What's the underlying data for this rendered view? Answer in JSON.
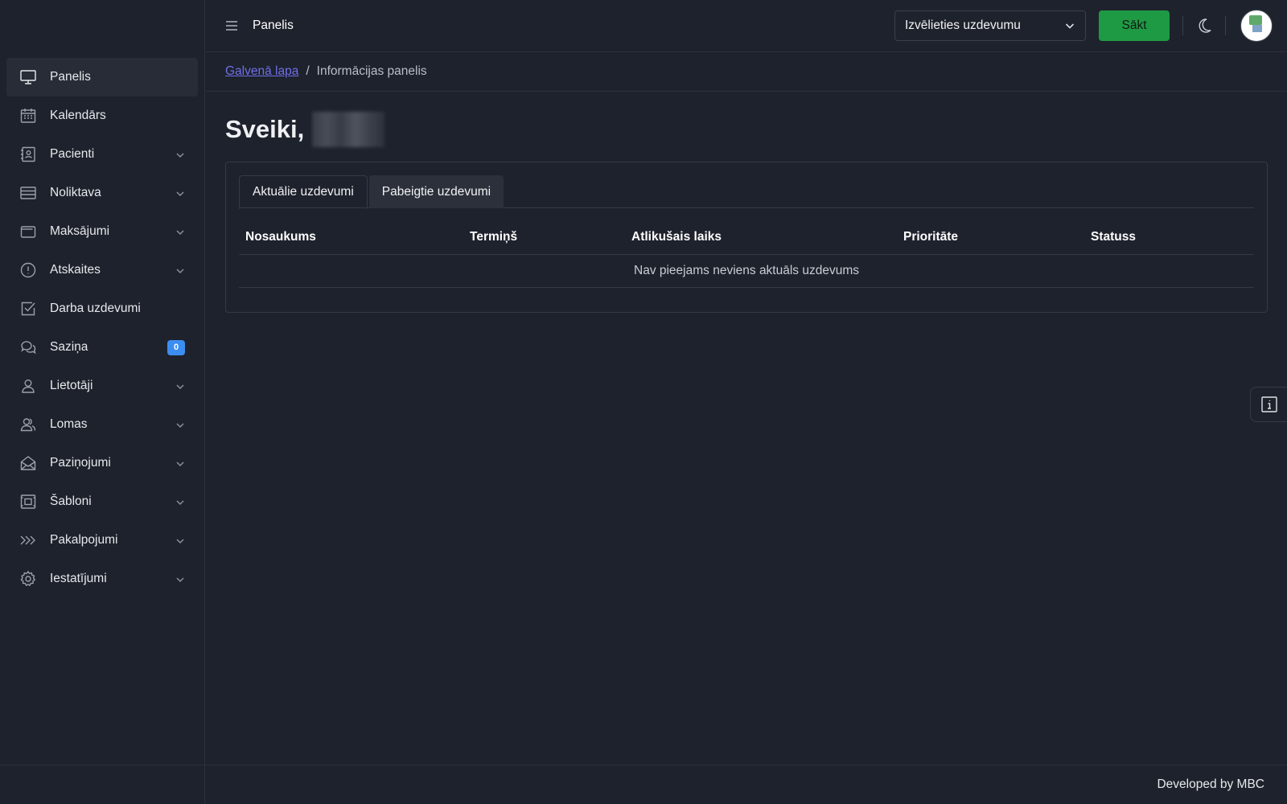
{
  "header": {
    "title": "Panelis",
    "task_select_value": "Izvēlieties uzdevumu",
    "start_label": "Sākt"
  },
  "sidebar": {
    "items": [
      {
        "label": "Panelis",
        "icon": "monitor-icon",
        "active": true
      },
      {
        "label": "Kalendārs",
        "icon": "calendar-icon"
      },
      {
        "label": "Pacienti",
        "icon": "contact-card-icon",
        "expandable": true
      },
      {
        "label": "Noliktava",
        "icon": "list-box-icon",
        "expandable": true
      },
      {
        "label": "Maksājumi",
        "icon": "wallet-icon",
        "expandable": true
      },
      {
        "label": "Atskaites",
        "icon": "alert-circle-icon",
        "expandable": true
      },
      {
        "label": "Darba uzdevumi",
        "icon": "checkbox-icon"
      },
      {
        "label": "Saziņa",
        "icon": "chat-icon",
        "badge": "0"
      },
      {
        "label": "Lietotāji",
        "icon": "user-icon",
        "expandable": true
      },
      {
        "label": "Lomas",
        "icon": "users-icon",
        "expandable": true
      },
      {
        "label": "Paziņojumi",
        "icon": "envelope-icon",
        "expandable": true
      },
      {
        "label": "Šabloni",
        "icon": "template-icon",
        "expandable": true
      },
      {
        "label": "Pakalpojumi",
        "icon": "double-chevron-icon",
        "expandable": true
      },
      {
        "label": "Iestatījumi",
        "icon": "gear-icon",
        "expandable": true
      }
    ]
  },
  "breadcrumb": {
    "home": "Galvenā lapa",
    "separator": "/",
    "current": "Informācijas panelis"
  },
  "main": {
    "greeting": "Sveiki,",
    "tabs": [
      {
        "label": "Aktuālie uzdevumi",
        "active": true
      },
      {
        "label": "Pabeigtie uzdevumi",
        "active": false
      }
    ],
    "table": {
      "columns": [
        "Nosaukums",
        "Termiņš",
        "Atlikušais laiks",
        "Prioritāte",
        "Statuss"
      ],
      "empty_message": "Nav pieejams neviens aktuāls uzdevums"
    }
  },
  "footer": {
    "credit": "Developed by MBC"
  },
  "colors": {
    "accent_green": "#1f9a44",
    "badge_blue": "#3b8ef0",
    "link": "#6f6ee8",
    "background": "#1e222c"
  }
}
